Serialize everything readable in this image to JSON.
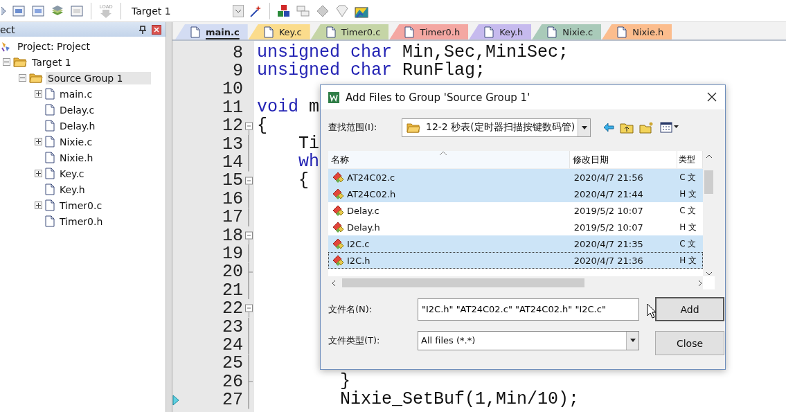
{
  "toolbar": {
    "load_button": {
      "label": "LOAD",
      "disabled": true
    },
    "target": "Target 1"
  },
  "project_panel": {
    "title": "ect",
    "tree": [
      {
        "label": "Project: Project",
        "kind": "project",
        "selected": false,
        "children": [
          {
            "label": "Target 1",
            "kind": "target",
            "expanded": true,
            "selected": false,
            "children": [
              {
                "label": "Source Group 1",
                "kind": "group",
                "expanded": true,
                "selected": true,
                "children": [
                  {
                    "label": "main.c",
                    "kind": "file",
                    "expanded": false,
                    "selected": false
                  },
                  {
                    "label": "Delay.c",
                    "kind": "file",
                    "selected": false
                  },
                  {
                    "label": "Delay.h",
                    "kind": "file",
                    "selected": false
                  },
                  {
                    "label": "Nixie.c",
                    "kind": "file",
                    "expanded": false,
                    "selected": false
                  },
                  {
                    "label": "Nixie.h",
                    "kind": "file",
                    "selected": false
                  },
                  {
                    "label": "Key.c",
                    "kind": "file",
                    "expanded": false,
                    "selected": false
                  },
                  {
                    "label": "Key.h",
                    "kind": "file",
                    "selected": false
                  },
                  {
                    "label": "Timer0.c",
                    "kind": "file",
                    "expanded": false,
                    "selected": false
                  },
                  {
                    "label": "Timer0.h",
                    "kind": "file",
                    "selected": false
                  }
                ]
              }
            ]
          }
        ]
      }
    ]
  },
  "editor": {
    "tabs": [
      {
        "label": "main.c",
        "color": "#d3dcf3",
        "selected": true
      },
      {
        "label": "Key.c",
        "color": "#fbdc8c",
        "selected": false
      },
      {
        "label": "Timer0.c",
        "color": "#c5d5a6",
        "selected": false
      },
      {
        "label": "Timer0.h",
        "color": "#f4a7a2",
        "selected": false
      },
      {
        "label": "Key.h",
        "color": "#c6baee",
        "selected": false
      },
      {
        "label": "Nixie.c",
        "color": "#a9cab9",
        "selected": false
      },
      {
        "label": "Nixie.h",
        "color": "#fcbd8d",
        "selected": false
      }
    ],
    "lines": [
      {
        "number": "8",
        "kind": "plain",
        "marker": false,
        "tokens": [
          {
            "text": "unsigned char",
            "kind": "keyword"
          },
          {
            "text": " Min,Sec,MiniSec;",
            "kind": "plain"
          }
        ]
      },
      {
        "number": "9",
        "kind": "plain",
        "marker": false,
        "tokens": [
          {
            "text": "unsigned char",
            "kind": "keyword"
          },
          {
            "text": " RunFlag;",
            "kind": "plain"
          }
        ]
      },
      {
        "number": "10",
        "kind": "plain",
        "marker": false
      },
      {
        "number": "11",
        "kind": "plain",
        "marker": false,
        "tokens": [
          {
            "text": "void",
            "kind": "keyword"
          },
          {
            "text": " m",
            "kind": "plain"
          }
        ]
      },
      {
        "number": "12",
        "kind": "foldstart",
        "marker": false,
        "tokens": [
          {
            "text": "{",
            "kind": "plain"
          }
        ]
      },
      {
        "number": "13",
        "kind": "folded",
        "marker": false,
        "tokens": [
          {
            "text": "    Ti",
            "kind": "plain"
          }
        ]
      },
      {
        "number": "14",
        "kind": "folded",
        "marker": false,
        "tokens": [
          {
            "text": "    wh",
            "kind": "keyword"
          }
        ]
      },
      {
        "number": "15",
        "kind": "foldstart",
        "marker": false,
        "tokens": [
          {
            "text": "    {",
            "kind": "plain"
          }
        ]
      },
      {
        "number": "16",
        "kind": "folded",
        "marker": false
      },
      {
        "number": "17",
        "kind": "folded",
        "marker": false
      },
      {
        "number": "18",
        "kind": "foldstart",
        "marker": false
      },
      {
        "number": "19",
        "kind": "folded",
        "marker": false
      },
      {
        "number": "20",
        "kind": "foldend",
        "marker": false
      },
      {
        "number": "21",
        "kind": "folded",
        "marker": false
      },
      {
        "number": "22",
        "kind": "foldstart",
        "marker": false
      },
      {
        "number": "23",
        "kind": "folded",
        "marker": false
      },
      {
        "number": "24",
        "kind": "folded",
        "marker": false
      },
      {
        "number": "25",
        "kind": "folded",
        "marker": false
      },
      {
        "number": "26",
        "kind": "foldend",
        "marker": false,
        "tokens": [
          {
            "text": "        }",
            "kind": "plain"
          }
        ]
      },
      {
        "number": "27",
        "kind": "folded",
        "marker": true,
        "tokens": [
          {
            "text": "        Nixie_SetBuf(1,Min/10);",
            "kind": "plain"
          }
        ]
      }
    ]
  },
  "dialog": {
    "title": "Add Files to Group 'Source Group 1'",
    "look_in": {
      "label": "查找范围(I):",
      "value": "12-2 秒表(定时器扫描按键数码管)"
    },
    "columns": [
      {
        "label": "名称",
        "sorted": true
      },
      {
        "label": "修改日期",
        "sorted": false
      },
      {
        "label": "类型",
        "sorted": false
      }
    ],
    "files": [
      {
        "name": "AT24C02.c",
        "date": "2020/4/7 21:56",
        "type": "C 文",
        "selected": true,
        "focused": false
      },
      {
        "name": "AT24C02.h",
        "date": "2020/4/7 21:44",
        "type": "H 文",
        "selected": true,
        "focused": false
      },
      {
        "name": "Delay.c",
        "date": "2019/5/2 10:07",
        "type": "C 文",
        "selected": false,
        "focused": false
      },
      {
        "name": "Delay.h",
        "date": "2019/5/2 10:07",
        "type": "H 文",
        "selected": false,
        "focused": false
      },
      {
        "name": "I2C.c",
        "date": "2020/4/7 21:35",
        "type": "C 文",
        "selected": true,
        "focused": false
      },
      {
        "name": "I2C.h",
        "date": "2020/4/7 21:36",
        "type": "H 文",
        "selected": true,
        "focused": true
      }
    ],
    "file_name": {
      "label": "文件名(N):",
      "value": "\"I2C.h\" \"AT24C02.c\" \"AT24C02.h\" \"I2C.c\""
    },
    "file_type": {
      "label": "文件类型(T):",
      "value": "All files (*.*)"
    },
    "buttons": [
      {
        "label": "Add",
        "focused": true
      },
      {
        "label": "Close",
        "focused": false
      }
    ]
  }
}
